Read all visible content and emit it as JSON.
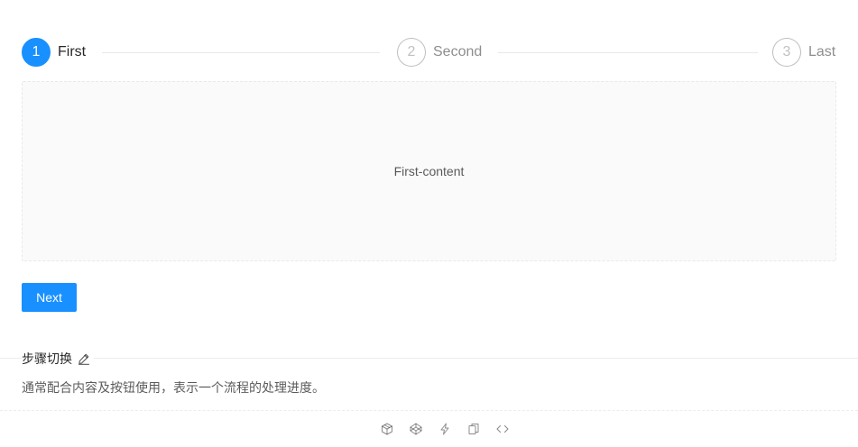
{
  "steps": [
    {
      "number": "1",
      "title": "First",
      "status": "process"
    },
    {
      "number": "2",
      "title": "Second",
      "status": "wait"
    },
    {
      "number": "3",
      "title": "Last",
      "status": "wait"
    }
  ],
  "content": {
    "text": "First-content"
  },
  "buttons": {
    "next_label": "Next"
  },
  "demo": {
    "title": "步骤切换",
    "description": "通常配合内容及按钮使用，表示一个流程的处理进度。"
  },
  "actions": [
    {
      "icon": "codesandbox-icon"
    },
    {
      "icon": "codepen-icon"
    },
    {
      "icon": "thunderbolt-icon"
    },
    {
      "icon": "copy-icon"
    },
    {
      "icon": "code-expand-icon"
    }
  ],
  "colors": {
    "primary": "#1890ff",
    "content_bg": "#fafafa"
  }
}
